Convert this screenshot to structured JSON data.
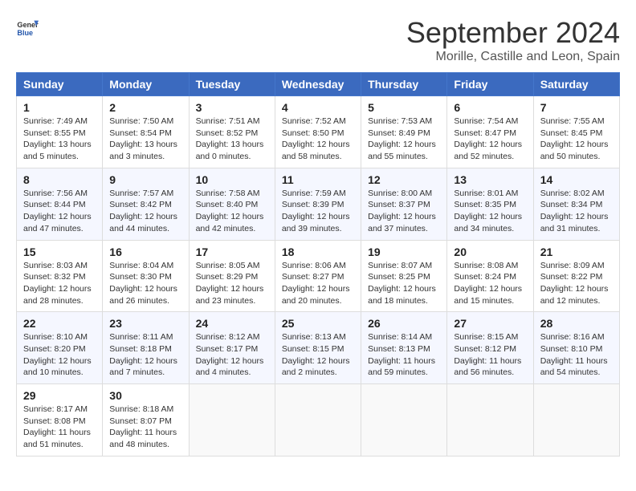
{
  "header": {
    "logo_general": "General",
    "logo_blue": "Blue",
    "title": "September 2024",
    "subtitle": "Morille, Castille and Leon, Spain"
  },
  "days_of_week": [
    "Sunday",
    "Monday",
    "Tuesday",
    "Wednesday",
    "Thursday",
    "Friday",
    "Saturday"
  ],
  "weeks": [
    [
      {
        "day": "1",
        "sunrise": "Sunrise: 7:49 AM",
        "sunset": "Sunset: 8:55 PM",
        "daylight": "Daylight: 13 hours and 5 minutes."
      },
      {
        "day": "2",
        "sunrise": "Sunrise: 7:50 AM",
        "sunset": "Sunset: 8:54 PM",
        "daylight": "Daylight: 13 hours and 3 minutes."
      },
      {
        "day": "3",
        "sunrise": "Sunrise: 7:51 AM",
        "sunset": "Sunset: 8:52 PM",
        "daylight": "Daylight: 13 hours and 0 minutes."
      },
      {
        "day": "4",
        "sunrise": "Sunrise: 7:52 AM",
        "sunset": "Sunset: 8:50 PM",
        "daylight": "Daylight: 12 hours and 58 minutes."
      },
      {
        "day": "5",
        "sunrise": "Sunrise: 7:53 AM",
        "sunset": "Sunset: 8:49 PM",
        "daylight": "Daylight: 12 hours and 55 minutes."
      },
      {
        "day": "6",
        "sunrise": "Sunrise: 7:54 AM",
        "sunset": "Sunset: 8:47 PM",
        "daylight": "Daylight: 12 hours and 52 minutes."
      },
      {
        "day": "7",
        "sunrise": "Sunrise: 7:55 AM",
        "sunset": "Sunset: 8:45 PM",
        "daylight": "Daylight: 12 hours and 50 minutes."
      }
    ],
    [
      {
        "day": "8",
        "sunrise": "Sunrise: 7:56 AM",
        "sunset": "Sunset: 8:44 PM",
        "daylight": "Daylight: 12 hours and 47 minutes."
      },
      {
        "day": "9",
        "sunrise": "Sunrise: 7:57 AM",
        "sunset": "Sunset: 8:42 PM",
        "daylight": "Daylight: 12 hours and 44 minutes."
      },
      {
        "day": "10",
        "sunrise": "Sunrise: 7:58 AM",
        "sunset": "Sunset: 8:40 PM",
        "daylight": "Daylight: 12 hours and 42 minutes."
      },
      {
        "day": "11",
        "sunrise": "Sunrise: 7:59 AM",
        "sunset": "Sunset: 8:39 PM",
        "daylight": "Daylight: 12 hours and 39 minutes."
      },
      {
        "day": "12",
        "sunrise": "Sunrise: 8:00 AM",
        "sunset": "Sunset: 8:37 PM",
        "daylight": "Daylight: 12 hours and 37 minutes."
      },
      {
        "day": "13",
        "sunrise": "Sunrise: 8:01 AM",
        "sunset": "Sunset: 8:35 PM",
        "daylight": "Daylight: 12 hours and 34 minutes."
      },
      {
        "day": "14",
        "sunrise": "Sunrise: 8:02 AM",
        "sunset": "Sunset: 8:34 PM",
        "daylight": "Daylight: 12 hours and 31 minutes."
      }
    ],
    [
      {
        "day": "15",
        "sunrise": "Sunrise: 8:03 AM",
        "sunset": "Sunset: 8:32 PM",
        "daylight": "Daylight: 12 hours and 28 minutes."
      },
      {
        "day": "16",
        "sunrise": "Sunrise: 8:04 AM",
        "sunset": "Sunset: 8:30 PM",
        "daylight": "Daylight: 12 hours and 26 minutes."
      },
      {
        "day": "17",
        "sunrise": "Sunrise: 8:05 AM",
        "sunset": "Sunset: 8:29 PM",
        "daylight": "Daylight: 12 hours and 23 minutes."
      },
      {
        "day": "18",
        "sunrise": "Sunrise: 8:06 AM",
        "sunset": "Sunset: 8:27 PM",
        "daylight": "Daylight: 12 hours and 20 minutes."
      },
      {
        "day": "19",
        "sunrise": "Sunrise: 8:07 AM",
        "sunset": "Sunset: 8:25 PM",
        "daylight": "Daylight: 12 hours and 18 minutes."
      },
      {
        "day": "20",
        "sunrise": "Sunrise: 8:08 AM",
        "sunset": "Sunset: 8:24 PM",
        "daylight": "Daylight: 12 hours and 15 minutes."
      },
      {
        "day": "21",
        "sunrise": "Sunrise: 8:09 AM",
        "sunset": "Sunset: 8:22 PM",
        "daylight": "Daylight: 12 hours and 12 minutes."
      }
    ],
    [
      {
        "day": "22",
        "sunrise": "Sunrise: 8:10 AM",
        "sunset": "Sunset: 8:20 PM",
        "daylight": "Daylight: 12 hours and 10 minutes."
      },
      {
        "day": "23",
        "sunrise": "Sunrise: 8:11 AM",
        "sunset": "Sunset: 8:18 PM",
        "daylight": "Daylight: 12 hours and 7 minutes."
      },
      {
        "day": "24",
        "sunrise": "Sunrise: 8:12 AM",
        "sunset": "Sunset: 8:17 PM",
        "daylight": "Daylight: 12 hours and 4 minutes."
      },
      {
        "day": "25",
        "sunrise": "Sunrise: 8:13 AM",
        "sunset": "Sunset: 8:15 PM",
        "daylight": "Daylight: 12 hours and 2 minutes."
      },
      {
        "day": "26",
        "sunrise": "Sunrise: 8:14 AM",
        "sunset": "Sunset: 8:13 PM",
        "daylight": "Daylight: 11 hours and 59 minutes."
      },
      {
        "day": "27",
        "sunrise": "Sunrise: 8:15 AM",
        "sunset": "Sunset: 8:12 PM",
        "daylight": "Daylight: 11 hours and 56 minutes."
      },
      {
        "day": "28",
        "sunrise": "Sunrise: 8:16 AM",
        "sunset": "Sunset: 8:10 PM",
        "daylight": "Daylight: 11 hours and 54 minutes."
      }
    ],
    [
      {
        "day": "29",
        "sunrise": "Sunrise: 8:17 AM",
        "sunset": "Sunset: 8:08 PM",
        "daylight": "Daylight: 11 hours and 51 minutes."
      },
      {
        "day": "30",
        "sunrise": "Sunrise: 8:18 AM",
        "sunset": "Sunset: 8:07 PM",
        "daylight": "Daylight: 11 hours and 48 minutes."
      },
      null,
      null,
      null,
      null,
      null
    ]
  ]
}
